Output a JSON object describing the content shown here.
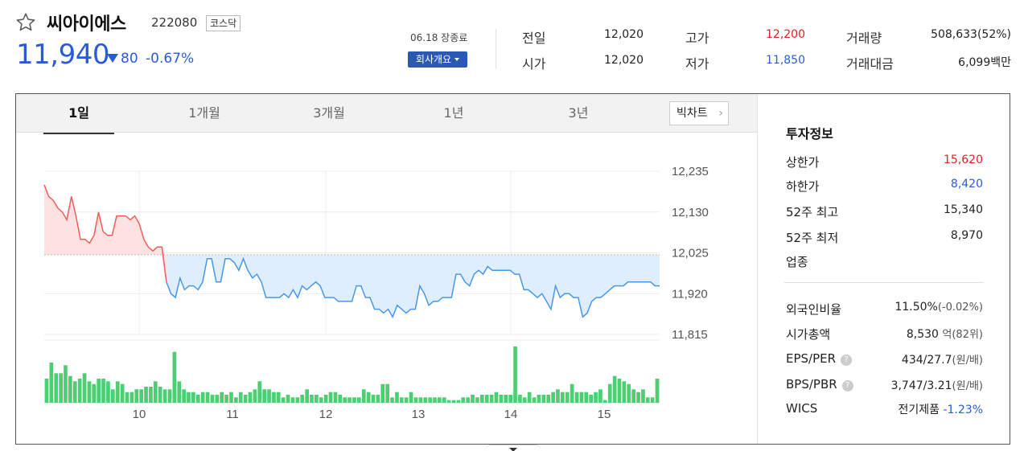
{
  "stock": {
    "name": "씨아이에스",
    "code": "222080",
    "market": "코스닥",
    "price": "11,940",
    "change": "80",
    "change_pct": "-0.67%",
    "close_info": "06.18 장종료",
    "corp_button": "회사개요"
  },
  "summary": [
    {
      "label": "전일",
      "value": "12,020",
      "tone": ""
    },
    {
      "label": "시가",
      "value": "12,020",
      "tone": ""
    },
    {
      "label": "고가",
      "value": "12,200",
      "tone": "up"
    },
    {
      "label": "저가",
      "value": "11,850",
      "tone": "dn"
    },
    {
      "label": "거래량",
      "value": "508,633(52%)",
      "tone": ""
    },
    {
      "label": "거래대금",
      "value": "6,099백만",
      "tone": ""
    }
  ],
  "tabs": [
    "1일",
    "1개월",
    "3개월",
    "1년",
    "3년"
  ],
  "bigchart_label": "빅차트",
  "chart_data": {
    "type": "line",
    "x_ticks": [
      "10",
      "11",
      "12",
      "13",
      "14",
      "15"
    ],
    "y_ticks": [
      "12,235",
      "12,130",
      "12,025",
      "11,920",
      "11,815"
    ],
    "ylim": [
      11815,
      12235
    ],
    "baseline": 12020,
    "price_series": [
      12200,
      12170,
      12160,
      12140,
      12130,
      12110,
      12170,
      12120,
      12060,
      12060,
      12050,
      12070,
      12130,
      12080,
      12070,
      12070,
      12120,
      12120,
      12120,
      12110,
      12120,
      12100,
      12060,
      12040,
      12030,
      12040,
      12040,
      11950,
      11920,
      11910,
      11960,
      11930,
      11940,
      11940,
      11930,
      11950,
      12010,
      12010,
      11950,
      11950,
      12010,
      12010,
      12000,
      11980,
      12010,
      11980,
      11960,
      11970,
      11950,
      11910,
      11910,
      11910,
      11910,
      11920,
      11910,
      11930,
      11910,
      11940,
      11930,
      11940,
      11950,
      11940,
      11910,
      11910,
      11910,
      11900,
      11900,
      11900,
      11900,
      11940,
      11940,
      11910,
      11910,
      11880,
      11880,
      11870,
      11880,
      11860,
      11890,
      11880,
      11870,
      11880,
      11880,
      11940,
      11920,
      11890,
      11900,
      11900,
      11910,
      11910,
      11910,
      11970,
      11970,
      11950,
      11940,
      11970,
      11980,
      11970,
      11990,
      11980,
      11980,
      11980,
      11980,
      11980,
      11970,
      11970,
      11930,
      11930,
      11920,
      11910,
      11920,
      11900,
      11880,
      11940,
      11910,
      11920,
      11920,
      11910,
      11910,
      11860,
      11870,
      11900,
      11910,
      11910,
      11920,
      11930,
      11940,
      11940,
      11940,
      11950,
      11950,
      11950,
      11950,
      11950,
      11950,
      11940,
      11940
    ],
    "volume_series": [
      45,
      75,
      55,
      55,
      70,
      50,
      40,
      45,
      55,
      40,
      35,
      45,
      45,
      40,
      25,
      40,
      35,
      20,
      20,
      25,
      25,
      30,
      30,
      40,
      30,
      25,
      25,
      95,
      40,
      25,
      20,
      20,
      15,
      20,
      20,
      15,
      15,
      20,
      15,
      20,
      10,
      20,
      15,
      20,
      25,
      40,
      25,
      25,
      20,
      20,
      10,
      15,
      10,
      10,
      15,
      25,
      15,
      15,
      10,
      15,
      20,
      20,
      15,
      10,
      10,
      10,
      10,
      25,
      20,
      15,
      15,
      35,
      35,
      10,
      20,
      10,
      10,
      20,
      10,
      10,
      10,
      10,
      10,
      10,
      10,
      5,
      5,
      5,
      10,
      10,
      15,
      10,
      15,
      15,
      15,
      20,
      15,
      15,
      15,
      105,
      15,
      10,
      20,
      10,
      15,
      15,
      15,
      20,
      25,
      20,
      20,
      35,
      20,
      20,
      20,
      15,
      20,
      25,
      5,
      35,
      50,
      45,
      40,
      35,
      25,
      20,
      25,
      10,
      10,
      45
    ]
  },
  "panel": {
    "title": "투자정보",
    "rows1": [
      {
        "label": "상한가",
        "value": "15,620",
        "tone": "up"
      },
      {
        "label": "하한가",
        "value": "8,420",
        "tone": "dn"
      },
      {
        "label": "52주 최고",
        "value": "15,340",
        "tone": ""
      },
      {
        "label": "52주 최저",
        "value": "8,970",
        "tone": ""
      },
      {
        "label": "업종",
        "value": "",
        "tone": ""
      }
    ],
    "foreign_label": "외국인비율",
    "foreign_value": "11.50%",
    "foreign_sub": "(-0.02%)",
    "mcap_label": "시가총액",
    "mcap_value": "8,530",
    "mcap_sub": "억(82위)",
    "eps_label": "EPS/PER",
    "eps_value": "434/27.7",
    "eps_sub": "(원/배)",
    "bps_label": "BPS/PBR",
    "bps_value": "3,747/3.21",
    "bps_sub": "(원/배)",
    "wics_label": "WICS",
    "wics_value": "전기제품",
    "wics_pct": "-1.23%"
  }
}
